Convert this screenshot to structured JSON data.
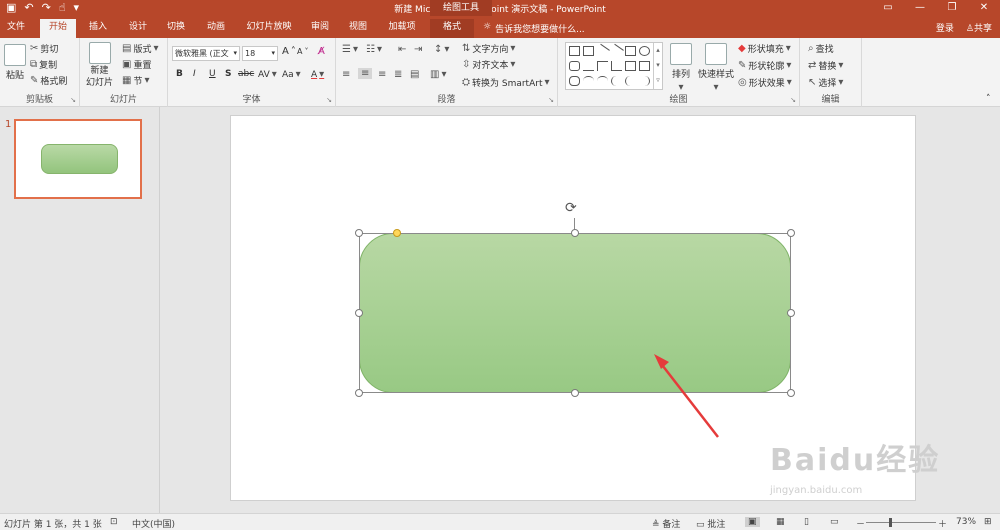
{
  "titlebar": {
    "title": "新建 Microsoft PowerPoint 演示文稿 - PowerPoint",
    "context_header": "绘图工具",
    "qat": [
      "save-icon",
      "undo-icon",
      "redo-icon",
      "touch-icon"
    ],
    "qat_glyphs": [
      "▣",
      "↶",
      "↷",
      "☝",
      "▾"
    ]
  },
  "tabs": [
    {
      "label": "文件"
    },
    {
      "label": "开始"
    },
    {
      "label": "插入"
    },
    {
      "label": "设计"
    },
    {
      "label": "切换"
    },
    {
      "label": "动画"
    },
    {
      "label": "幻灯片放映"
    },
    {
      "label": "审阅"
    },
    {
      "label": "视图"
    },
    {
      "label": "加载项"
    },
    {
      "label": "格式"
    }
  ],
  "tell_me": "告诉我您想要做什么...",
  "account": {
    "login": "登录",
    "share": "共享"
  },
  "window_controls": [
    "▭",
    "—",
    "❐",
    "✕"
  ],
  "ribbon": {
    "clipboard": {
      "paste": "粘贴",
      "cut": "剪切",
      "copy": "复制",
      "format_painter": "格式刷",
      "label": "剪贴板"
    },
    "slides": {
      "new_slide": "新建",
      "new_slide2": "幻灯片",
      "layout": "版式",
      "reset": "重置",
      "section": "节",
      "label": "幻灯片"
    },
    "font": {
      "font_name": "微软雅黑 (正文",
      "font_size": "18",
      "bold": "B",
      "italic": "I",
      "underline": "U",
      "shadow": "S",
      "strike": "abc",
      "spacing": "AV",
      "case": "Aa",
      "color": "A",
      "grow": "A",
      "shrink": "A",
      "label": "字体"
    },
    "paragraph": {
      "text_direction": "文字方向",
      "align_text": "对齐文本",
      "smartart": "转换为 SmartArt",
      "label": "段落"
    },
    "drawing": {
      "arrange": "排列",
      "quick_styles": "快速样式",
      "fill": "形状填充",
      "outline": "形状轮廓",
      "effects": "形状效果",
      "label": "绘图"
    },
    "editing": {
      "find": "查找",
      "replace": "替换",
      "select": "选择",
      "label": "编辑"
    }
  },
  "thumbnails": [
    {
      "number": "1"
    }
  ],
  "statusbar": {
    "slide_info": "幻灯片 第 1 张，共 1 张",
    "language": "中文(中国)",
    "notes": "备注",
    "comments": "批注",
    "zoom_minus": "－",
    "zoom_plus": "＋",
    "zoom": "73%"
  },
  "watermark": {
    "logo": "Baidu经验",
    "url": "jingyan.baidu.com"
  },
  "colors": {
    "accent": "#b7472a",
    "shape_fill": "#a6cf93",
    "arrow": "#e53b3b"
  }
}
